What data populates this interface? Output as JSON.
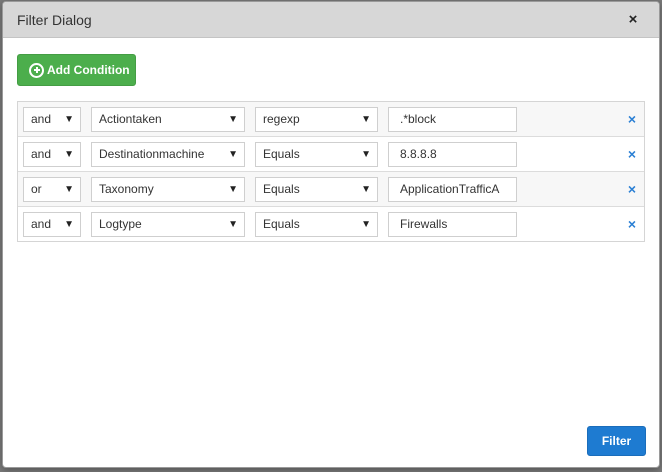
{
  "dialog": {
    "title": "Filter Dialog",
    "close_label": "×",
    "add_condition_label": "Add Condition",
    "filter_label": "Filter"
  },
  "conditions": [
    {
      "op": "and",
      "field": "Actiontaken",
      "comparator": "regexp",
      "value": ".*block",
      "remove": "×"
    },
    {
      "op": "and",
      "field": "Destinationmachine",
      "comparator": "Equals",
      "value": "8.8.8.8",
      "remove": "×"
    },
    {
      "op": "or",
      "field": "Taxonomy",
      "comparator": "Equals",
      "value": "ApplicationTrafficA",
      "remove": "×"
    },
    {
      "op": "and",
      "field": "Logtype",
      "comparator": "Equals",
      "value": "Firewalls",
      "remove": "×"
    }
  ],
  "icons": {
    "dropdown": "▼"
  },
  "colors": {
    "add_button": "#4cae4c",
    "filter_button": "#1e7bd1",
    "remove_icon": "#2a7fd4",
    "header_bg": "#d7d7d7"
  }
}
